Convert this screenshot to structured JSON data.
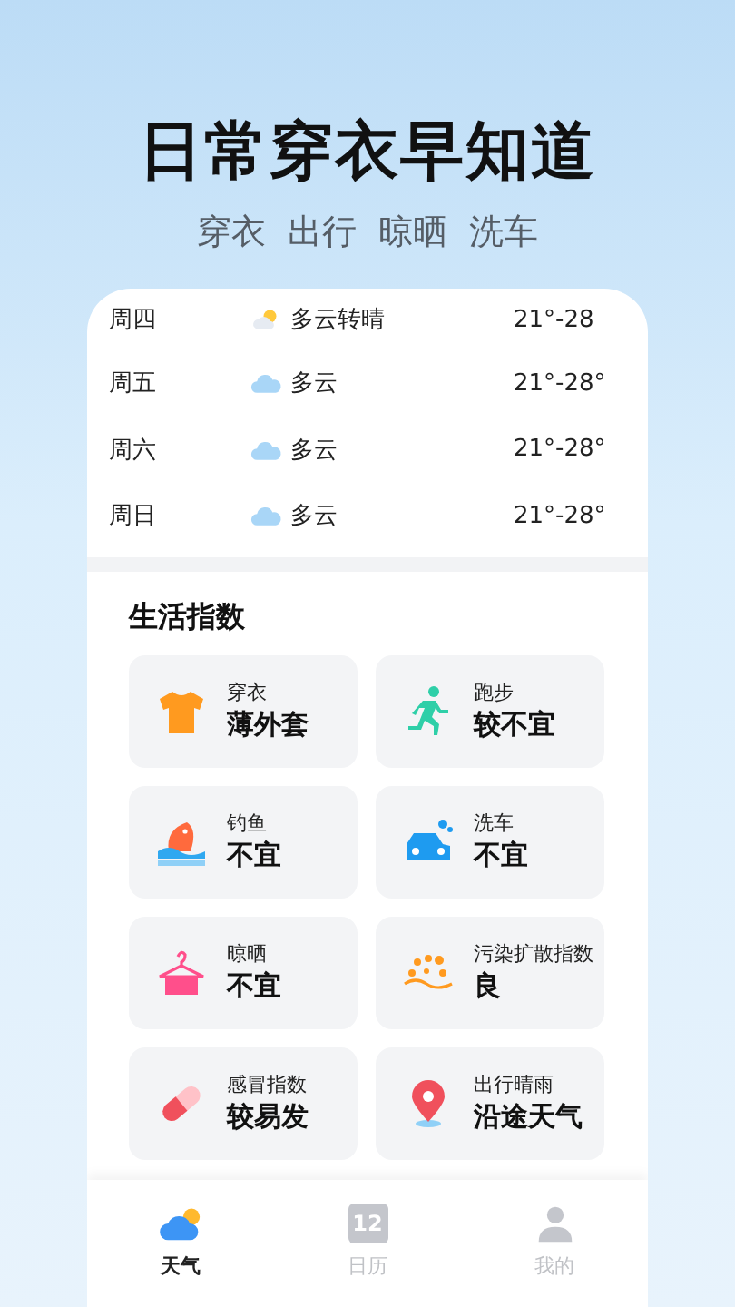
{
  "headline": "日常穿衣早知道",
  "subtitle": [
    "穿衣",
    "出行",
    "晾晒",
    "洗车"
  ],
  "forecast": [
    {
      "day": "周四",
      "kind": "partly_sunny",
      "weather": "多云转晴",
      "temp": "21°-28"
    },
    {
      "day": "周五",
      "kind": "cloudy",
      "weather": "多云",
      "temp": "21°-28°"
    },
    {
      "day": "周六",
      "kind": "cloudy",
      "weather": "多云",
      "temp": "21°-28°"
    },
    {
      "day": "周日",
      "kind": "cloudy",
      "weather": "多云",
      "temp": "21°-28°"
    }
  ],
  "life_index": {
    "title": "生活指数",
    "items": [
      {
        "kind": "clothing",
        "name": "穿衣",
        "value": "薄外套"
      },
      {
        "kind": "running",
        "name": "跑步",
        "value": "较不宜"
      },
      {
        "kind": "fishing",
        "name": "钓鱼",
        "value": "不宜"
      },
      {
        "kind": "car_wash",
        "name": "洗车",
        "value": "不宜"
      },
      {
        "kind": "drying",
        "name": "晾晒",
        "value": "不宜"
      },
      {
        "kind": "pollution",
        "name": "污染扩散指数",
        "value": "良"
      },
      {
        "kind": "cold",
        "name": "感冒指数",
        "value": "较易发"
      },
      {
        "kind": "travel",
        "name": "出行晴雨",
        "value": "沿途天气"
      }
    ]
  },
  "tab_bar": [
    {
      "kind": "weather",
      "label": "天气",
      "selected": true
    },
    {
      "kind": "calendar",
      "label": "日历",
      "icon_text": "12",
      "selected": false
    },
    {
      "kind": "profile",
      "label": "我的",
      "selected": false
    }
  ]
}
